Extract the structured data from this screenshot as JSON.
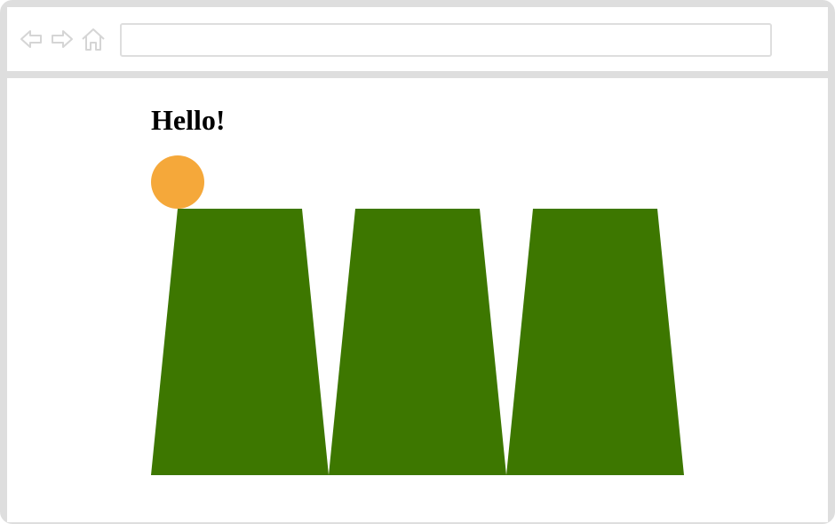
{
  "browser": {
    "address_value": "",
    "icons": [
      "back-arrow-icon",
      "forward-arrow-icon",
      "home-icon"
    ]
  },
  "page": {
    "heading": "Hello!"
  },
  "scene": {
    "ball_color": "#f5a83a",
    "trapezoid_color": "#3d7700",
    "trapezoid_count": 3
  },
  "colors": {
    "frame": "#dedede",
    "background": "#ffffff",
    "icon_stroke": "#d5d5d5"
  }
}
